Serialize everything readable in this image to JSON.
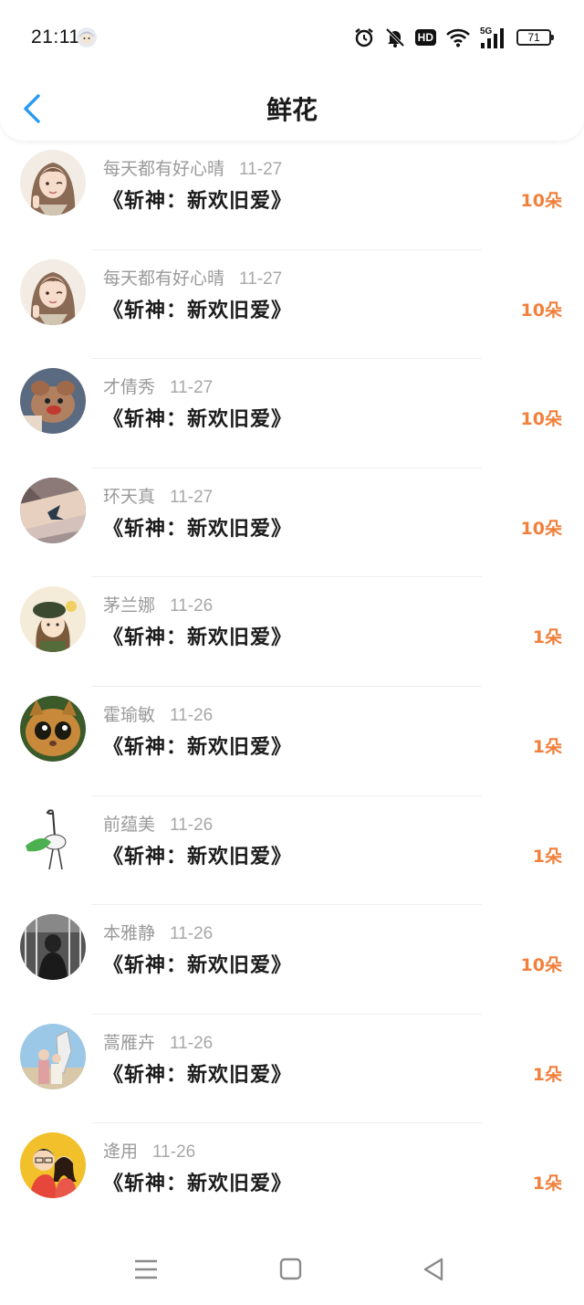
{
  "status_bar": {
    "time": "21:11",
    "network": "5G",
    "hd_label": "HD",
    "battery": "71",
    "icons": [
      "alarm-icon",
      "mute-bell-icon",
      "hd-icon",
      "wifi-icon",
      "signal-5g-icon",
      "battery-icon"
    ]
  },
  "header": {
    "title": "鲜花",
    "back_icon": "chevron-left-icon",
    "accent_color": "#2a9af0"
  },
  "flowers": [
    {
      "user": "每天都有好心晴",
      "date": "11-27",
      "book": "《斩神：新欢旧爱》",
      "amount": "10朵",
      "avatar": "girl-peace-sign"
    },
    {
      "user": "每天都有好心晴",
      "date": "11-27",
      "book": "《斩神：新欢旧爱》",
      "amount": "10朵",
      "avatar": "girl-peace-sign"
    },
    {
      "user": "才倩秀",
      "date": "11-27",
      "book": "《斩神：新欢旧爱》",
      "amount": "10朵",
      "avatar": "plush-toy"
    },
    {
      "user": "环天真",
      "date": "11-27",
      "book": "《斩神：新欢旧爱》",
      "amount": "10朵",
      "avatar": "tattoo-arm"
    },
    {
      "user": "茅兰娜",
      "date": "11-26",
      "book": "《斩神：新欢旧爱》",
      "amount": "1朵",
      "avatar": "girl-beret"
    },
    {
      "user": "霍瑜敏",
      "date": "11-26",
      "book": "《斩神：新欢旧爱》",
      "amount": "1朵",
      "avatar": "cat-face"
    },
    {
      "user": "前蕴美",
      "date": "11-26",
      "book": "《斩神：新欢旧爱》",
      "amount": "1朵",
      "avatar": "ostrich-sketch"
    },
    {
      "user": "本雅静",
      "date": "11-26",
      "book": "《斩神：新欢旧爱》",
      "amount": "10朵",
      "avatar": "bw-photo"
    },
    {
      "user": "蒿雁卉",
      "date": "11-26",
      "book": "《斩神：新欢旧爱》",
      "amount": "1朵",
      "avatar": "horse-girls"
    },
    {
      "user": "逄用",
      "date": "11-26",
      "book": "《斩神：新欢旧爱》",
      "amount": "1朵",
      "avatar": "cartoon-couple"
    }
  ],
  "amount_color": "#f0803c",
  "nav_bar": {
    "icons": [
      "menu-icon",
      "home-square-icon",
      "back-triangle-icon"
    ]
  }
}
